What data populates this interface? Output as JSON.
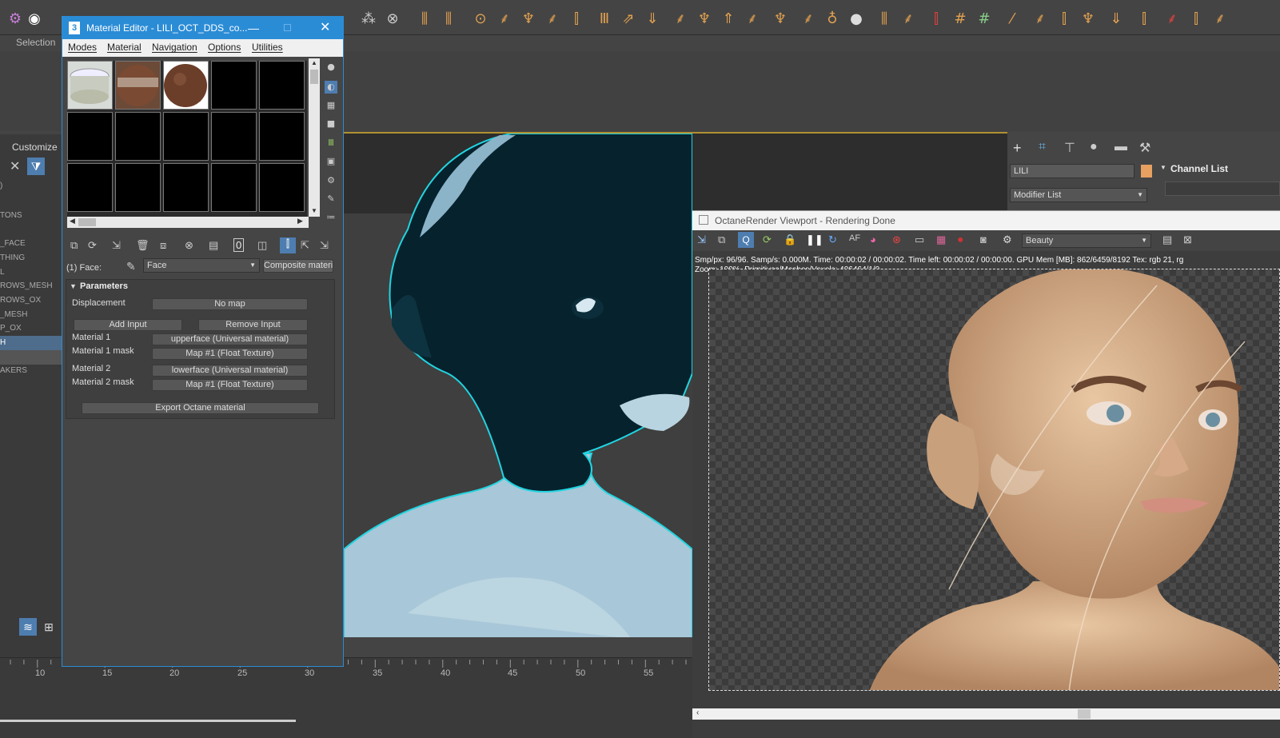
{
  "toolbar": {
    "selection_label": "Selection"
  },
  "left_panel": {
    "customize_label": "Customize",
    "scene_items": [
      {
        "label": ")",
        "selected": false
      },
      {
        "label": "TONS",
        "selected": false
      },
      {
        "label": "_FACE",
        "selected": false
      },
      {
        "label": "THING",
        "selected": false
      },
      {
        "label": "L",
        "selected": false
      },
      {
        "label": "ROWS_MESH",
        "selected": false
      },
      {
        "label": "ROWS_OX",
        "selected": false
      },
      {
        "label": "_MESH",
        "selected": false
      },
      {
        "label": "P_OX",
        "selected": false
      },
      {
        "label": "H",
        "selected": true
      },
      {
        "label": "",
        "selected": false
      },
      {
        "label": "AKERS",
        "selected": false
      }
    ]
  },
  "timeline": {
    "ticks": [
      "10",
      "15",
      "20",
      "25",
      "30",
      "35",
      "40",
      "45",
      "50",
      "55"
    ]
  },
  "material_editor": {
    "title": "Material Editor - LILI_OCT_DDS_co...",
    "menu": [
      "Modes",
      "Material",
      "Navigation",
      "Options",
      "Utilities"
    ],
    "face_label": "(1) Face:",
    "face_value": "Face",
    "type_button": "Composite materia",
    "section_title": "Parameters",
    "displacement_label": "Displacement",
    "displacement_value": "No map",
    "add_input": "Add Input",
    "remove_input": "Remove Input",
    "rows": [
      {
        "label": "Material 1",
        "value": "upperface (Universal material)"
      },
      {
        "label": "Material 1 mask",
        "value": "Map #1 (Float Texture)"
      },
      {
        "label": "Material 2",
        "value": "lowerface (Universal material)"
      },
      {
        "label": "Material 2 mask",
        "value": "Map #1 (Float Texture)"
      }
    ],
    "export_button": "Export Octane material"
  },
  "command_panel": {
    "object_name": "LILI",
    "modifier_list": "Modifier List",
    "channel_list": "Channel List",
    "color": "#e8a060"
  },
  "octane": {
    "title": "OctaneRender Viewport - Rendering Done",
    "pass": "Beauty",
    "status_line1": "Smp/px: 96/96.   Samp/s: 0.000M.   Time: 00:00:02 / 00:00:02.   Time left: 00:00:02 / 00:00:00.   GPU Mem [MB]: 862/6459/8192   Tex: rgb 21, rg",
    "status_line2": "Zoom: 100%.   Primitives/Meshes/Voxels: 406464/1/0"
  }
}
